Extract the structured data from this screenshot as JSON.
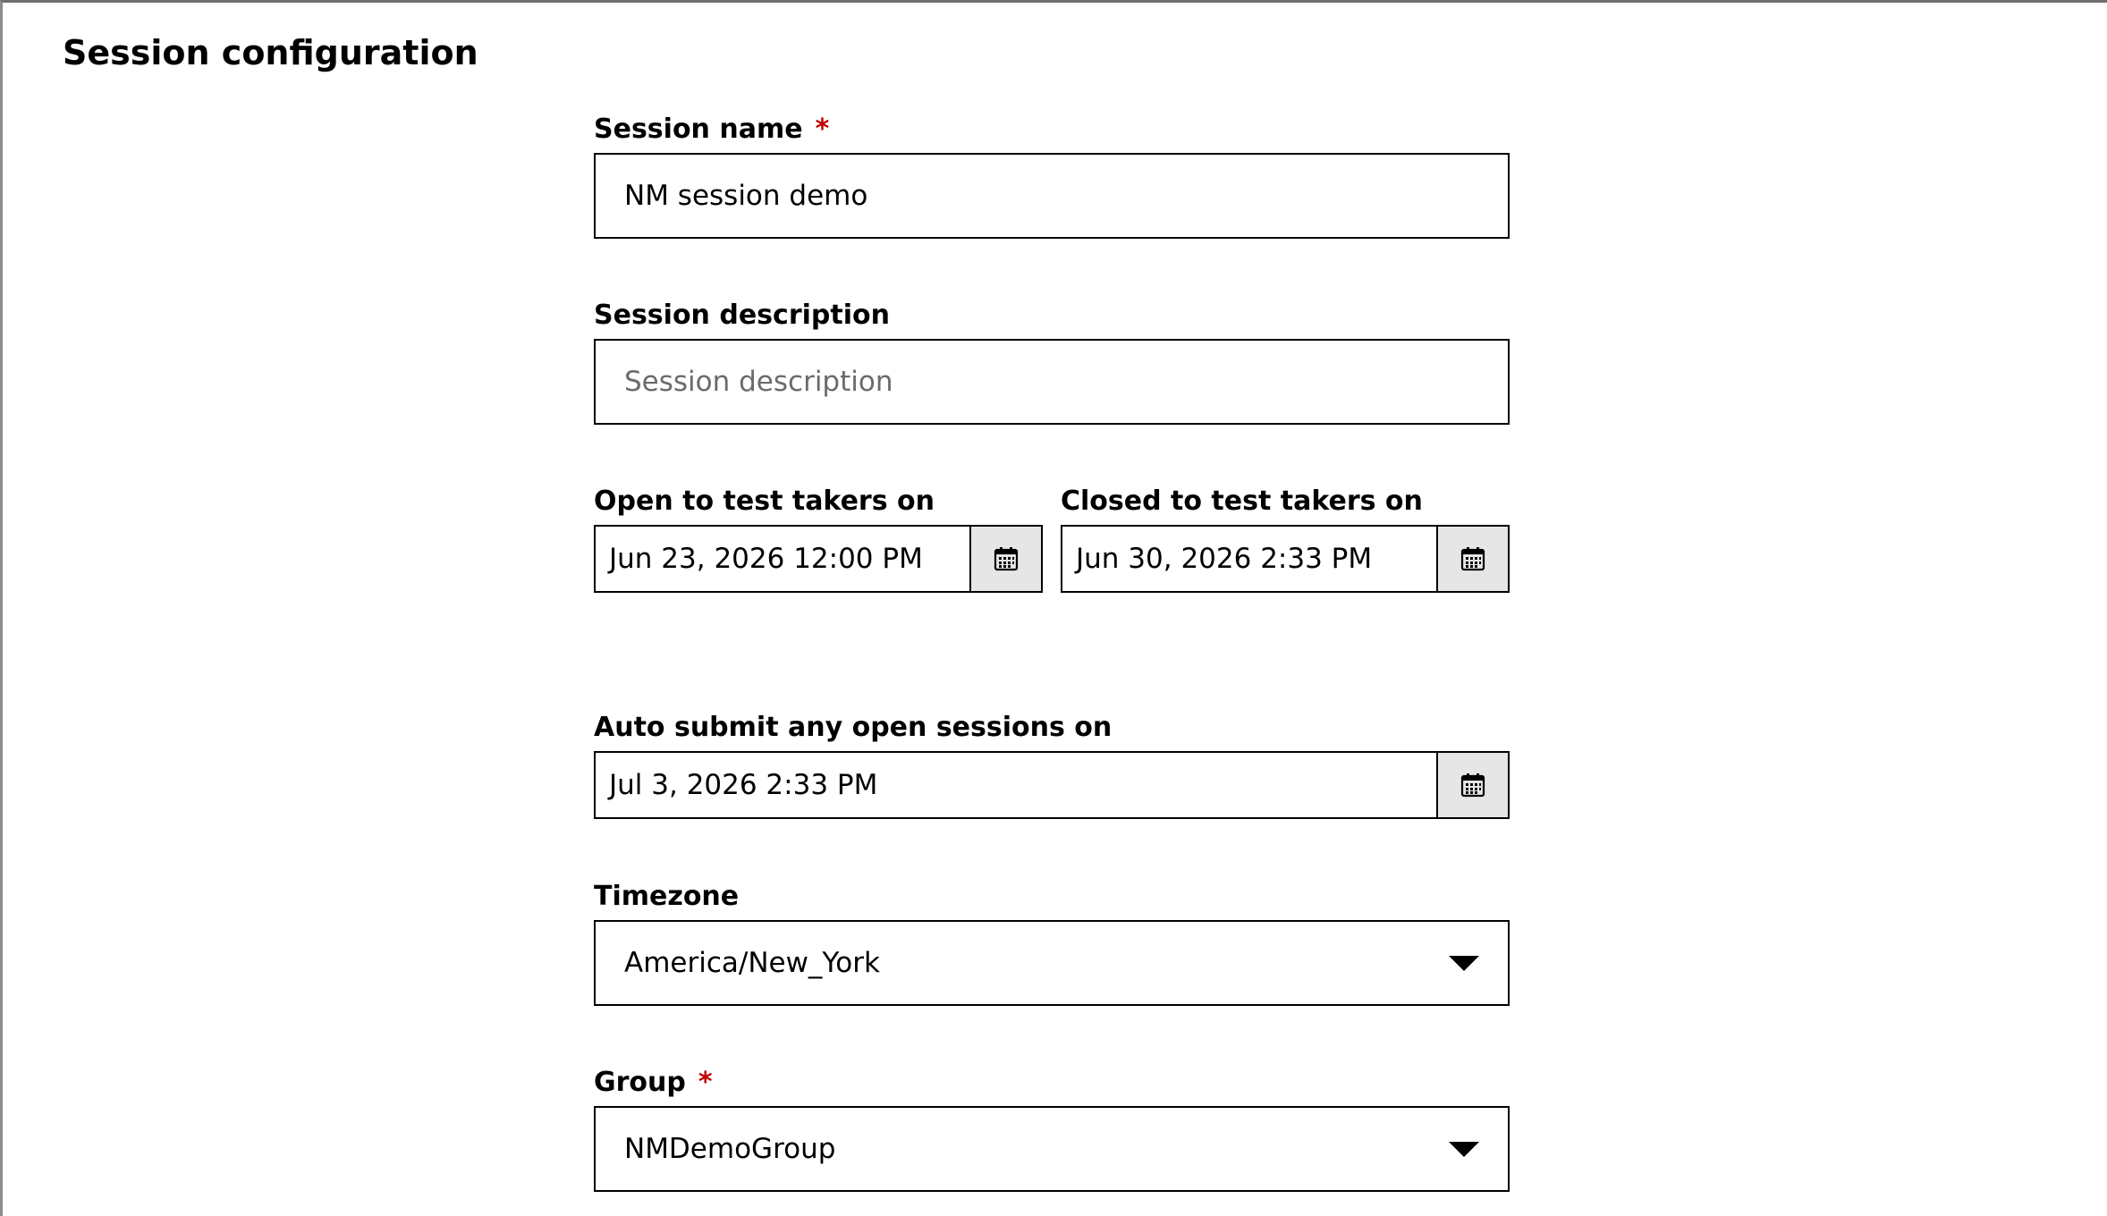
{
  "section": {
    "title": "Session configuration"
  },
  "fields": {
    "session_name": {
      "label": "Session name",
      "required_mark": "*",
      "value": "NM session demo"
    },
    "session_description": {
      "label": "Session description",
      "placeholder": "Session description",
      "value": ""
    },
    "open_date": {
      "label": "Open to test takers on",
      "value": "Jun 23, 2026 12:00 PM",
      "icon": "calendar-icon"
    },
    "close_date": {
      "label": "Closed to test takers on",
      "value": "Jun 30, 2026 2:33 PM",
      "icon": "calendar-icon"
    },
    "auto_submit_date": {
      "label": "Auto submit any open sessions on",
      "value": "Jul 3, 2026 2:33 PM",
      "icon": "calendar-icon"
    },
    "timezone": {
      "label": "Timezone",
      "value": "America/New_York",
      "icon": "chevron-down-icon"
    },
    "group": {
      "label": "Group",
      "required_mark": "*",
      "value": "NMDemoGroup",
      "icon": "chevron-down-icon"
    }
  },
  "colors": {
    "required": "#c00000",
    "border": "#000000",
    "calendar_button_bg": "#e6e6e6",
    "placeholder": "#6b6b6b"
  }
}
